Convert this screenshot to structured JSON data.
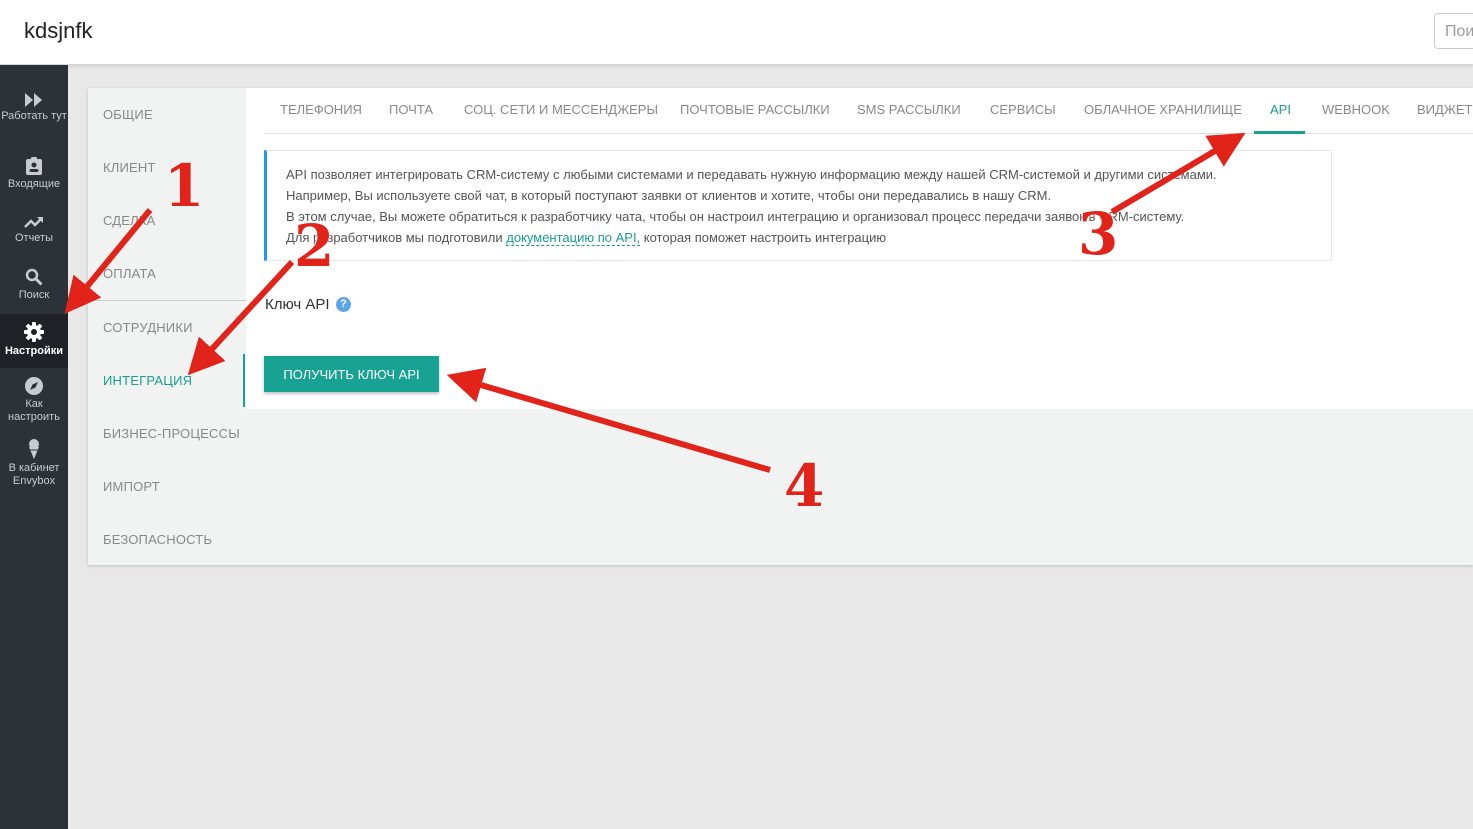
{
  "header": {
    "title": "kdsjnfk",
    "search_placeholder": "Пои"
  },
  "sidebar": {
    "items": [
      {
        "icon": "fast-forward-icon",
        "label": "Работать тут"
      },
      {
        "icon": "clipboard-icon",
        "label": "Входящие"
      },
      {
        "icon": "trending-up-icon",
        "label": "Отчеты"
      },
      {
        "icon": "search-icon",
        "label": "Поиск"
      },
      {
        "icon": "gear-icon",
        "label": "Настройки"
      },
      {
        "icon": "compass-icon",
        "label": "Как настроить"
      },
      {
        "icon": "ice-cream-icon",
        "label": "В кабинет Envybox"
      }
    ]
  },
  "settings_nav": {
    "items": [
      "ОБЩИЕ",
      "КЛИЕНТ",
      "СДЕЛКА",
      "ОПЛАТА",
      "СОТРУДНИКИ",
      "ИНТЕГРАЦИЯ",
      "БИЗНЕС-ПРОЦЕССЫ",
      "ИМПОРТ",
      "БЕЗОПАСНОСТЬ"
    ],
    "active": "ИНТЕГРАЦИЯ"
  },
  "tabs": {
    "items": [
      "ТЕЛЕФОНИЯ",
      "ПОЧТА",
      "СОЦ. СЕТИ И МЕССЕНДЖЕРЫ",
      "ПОЧТОВЫЕ РАССЫЛКИ",
      "SMS РАССЫЛКИ",
      "СЕРВИСЫ",
      "ОБЛАЧНОЕ ХРАНИЛИЩЕ",
      "API",
      "WEBHOOK",
      "ВИДЖЕТЫ"
    ],
    "active": "API"
  },
  "info": {
    "line1": "API позволяет интегрировать CRM-систему с любыми системами и передавать нужную информацию между нашей CRM-системой и другими системами.",
    "line2": "Например, Вы используете свой чат, в который поступают заявки от клиентов и хотите, чтобы они передавались в нашу CRM.",
    "line3": "В этом случае, Вы можете обратиться к разработчику чата, чтобы он настроил интеграцию и организовал процесс передачи заявок в CRM-систему.",
    "line4_before": "Для разработчиков мы подготовили ",
    "line4_link": "документацию по API,",
    "line4_after": " которая поможет настроить интеграцию"
  },
  "api_key": {
    "label": "Ключ API",
    "help": "?",
    "button": "ПОЛУЧИТЬ КЛЮЧ API"
  },
  "annotations": {
    "color": "#e2231a",
    "labels": [
      "1",
      "2",
      "3",
      "4"
    ]
  },
  "colors": {
    "accent": "#1a9e92",
    "sidebar_bg": "#2d3239",
    "info_border": "#2196f3"
  }
}
